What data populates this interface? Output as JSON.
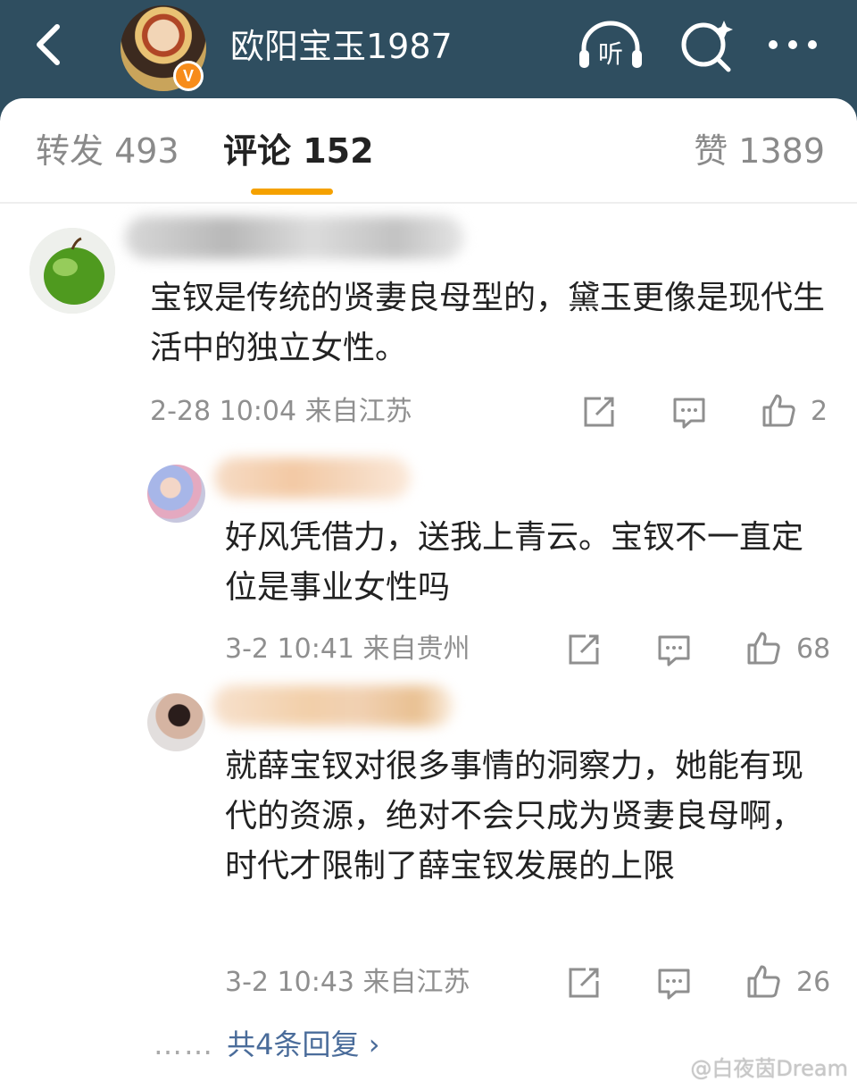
{
  "header": {
    "username": "欧阳宝玉1987",
    "verified_badge": "V",
    "icons": [
      "back-arrow-icon",
      "listen-icon",
      "search-icon",
      "more-icon"
    ],
    "listen_glyph": "听"
  },
  "tabs": {
    "repost": "转发 493",
    "comment": "评论 152",
    "like": "赞 1389"
  },
  "comments": [
    {
      "text": "宝钗是传统的贤妻良母型的，黛玉更像是现代生活中的独立女性。",
      "meta": "2-28 10:04  来自江苏",
      "likes": "2"
    },
    {
      "text": "好风凭借力，送我上青云。宝钗不一直定位是事业女性吗",
      "meta": "3-2 10:41  来自贵州",
      "likes": "68"
    },
    {
      "text": "就薛宝钗对很多事情的洞察力，她能有现代的资源，绝对不会只成为贤妻良母啊，时代才限制了薛宝钗发展的上限",
      "meta": "3-2 10:43  来自江苏",
      "likes": "26"
    }
  ],
  "replies": {
    "dots": "……",
    "label": "共4条回复 ›"
  },
  "watermark": "@白夜茵Dream",
  "colors": {
    "header_bg": "#2f4e60",
    "tab_accent": "#f5a100",
    "badge": "#f78c1b",
    "link": "#4a6c9a"
  }
}
